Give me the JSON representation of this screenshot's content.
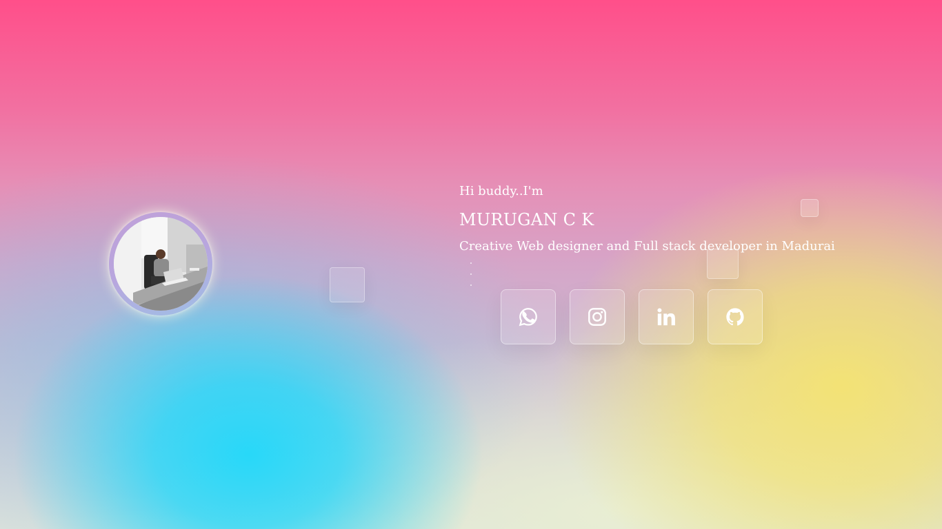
{
  "hero": {
    "greeting": "Hi buddy..I'm",
    "name": "MURUGAN C K",
    "tagline": "Creative Web designer and Full stack developer in Madurai"
  },
  "profile": {
    "avatar_alt": "Profile photo"
  },
  "social_links": [
    {
      "id": "whatsapp",
      "icon": "whatsapp-icon"
    },
    {
      "id": "instagram",
      "icon": "instagram-icon"
    },
    {
      "id": "linkedin",
      "icon": "linkedin-icon"
    },
    {
      "id": "github",
      "icon": "github-icon"
    }
  ],
  "colors": {
    "top_pink": "#ff4f8a",
    "cyan_glow": "#20d8fa",
    "yellow_glow": "#f5e470",
    "text": "#ffffff"
  }
}
